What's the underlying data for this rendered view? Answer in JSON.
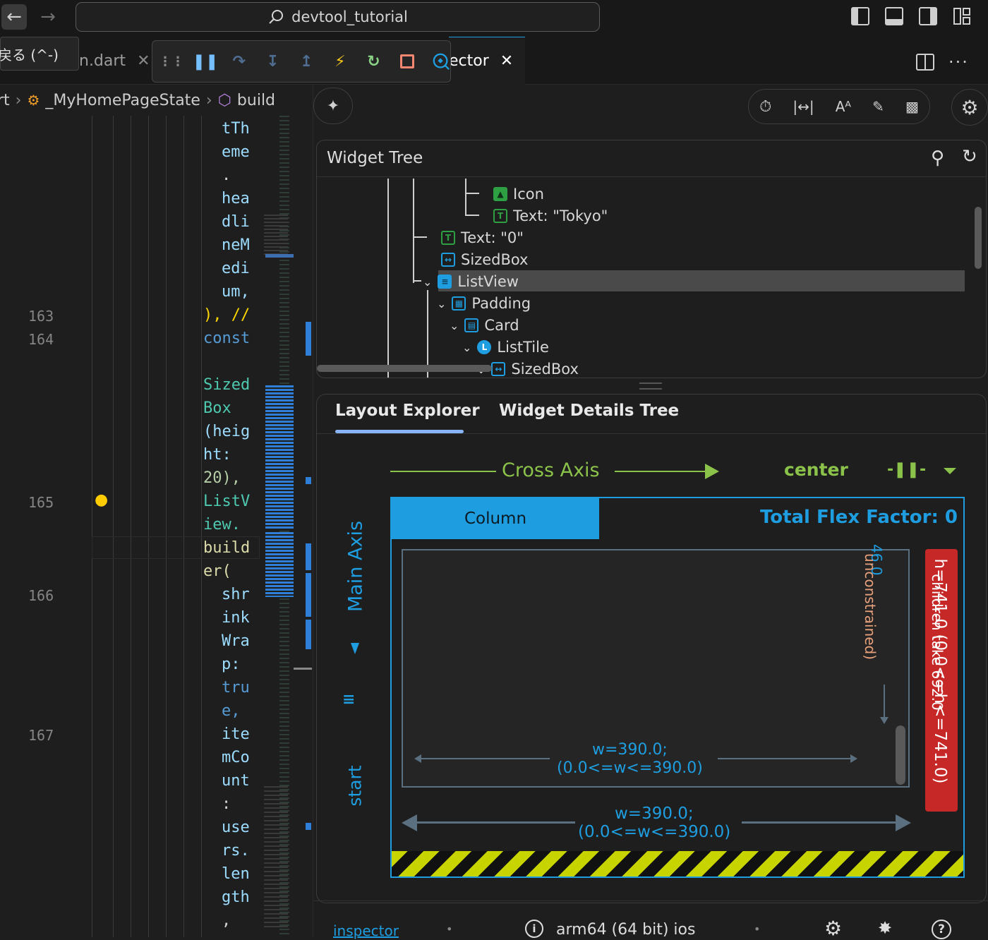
{
  "titlebar": {
    "search_text": "devtool_tutorial",
    "back_icon": "arrow-left-icon",
    "forward_icon": "arrow-right-icon"
  },
  "tooltip": {
    "text": "戻る (^-)"
  },
  "tabs": [
    {
      "label": "n.dart"
    },
    {
      "label": "ector"
    }
  ],
  "breadcrumb": {
    "first": "rt",
    "class_name": "_MyHomePageState",
    "method": "build"
  },
  "editor": {
    "line_numbers": {
      "l163": "163",
      "l164": "164",
      "l165": "165",
      "l166": "166",
      "l167": "167"
    },
    "code": {
      "c1": "tTh",
      "c2": "eme",
      "c3": ".",
      "c4": "hea",
      "c5": "dli",
      "c6": "neM",
      "c7": "edi",
      "c8": "um,",
      "c9": "), //",
      "c10": "const",
      "c11": "Sized",
      "c12": "Box",
      "c13": "(heig",
      "c14": "ht:",
      "c15": "20),",
      "c16": "ListV",
      "c17": "iew.",
      "c18": "build",
      "c19": "er(",
      "c20": "shr",
      "c21": "ink",
      "c22": "Wra",
      "c23": "p:",
      "c24": "tru",
      "c25": "e,",
      "c26": "ite",
      "c27": "mCo",
      "c28": "unt",
      "c29": ":",
      "c30": "use",
      "c31": "rs.",
      "c32": "len",
      "c33": "gth",
      "c34": ","
    }
  },
  "widget_tree": {
    "title": "Widget Tree",
    "rows": [
      {
        "label": "Icon"
      },
      {
        "label": "Text: \"Tokyo\""
      },
      {
        "label": "Text: \"0\""
      },
      {
        "label": "SizedBox"
      },
      {
        "label": "ListView"
      },
      {
        "label": "Padding"
      },
      {
        "label": "Card"
      },
      {
        "label": "ListTile"
      },
      {
        "label": "SizedBox"
      }
    ]
  },
  "details": {
    "tabs": {
      "layout": "Layout Explorer",
      "details_tree": "Widget Details Tree"
    },
    "cross_axis_label": "Cross Axis",
    "cross_axis_value": "center",
    "main_axis_label": "Main Axis",
    "main_axis_value": "start",
    "widget_name": "Column",
    "total_flex": "Total Flex Factor: 0",
    "height_label": "h=741.0 (0.0<=h<=741.0)",
    "height_label_2": "children take 692.0",
    "child_height": "46.0",
    "child_unconstrained": "unconstrained)",
    "inner_w1": "w=390.0;",
    "inner_w2": "(0.0<=w<=390.0)",
    "outer_w1": "w=390.0;",
    "outer_w2": "(0.0<=w<=390.0)"
  },
  "statusbar": {
    "inspector": "inspector",
    "device": "arm64 (64 bit) ios"
  },
  "colors": {
    "accent_blue": "#1e9ee0",
    "green": "#8bc34a",
    "red": "#d32f2f",
    "selection": "#4a4a4a"
  }
}
